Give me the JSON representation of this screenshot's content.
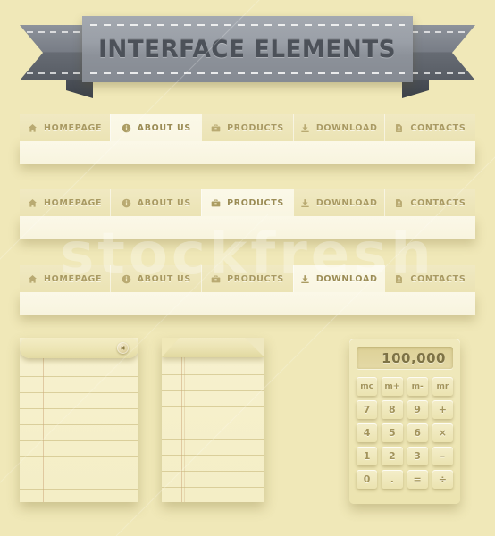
{
  "page": {
    "background_color": "#f0e8b8",
    "watermark_text": "stockfresh"
  },
  "banner": {
    "title": "INTERFACE ELEMENTS",
    "ribbon_color": "#9a9fa7",
    "title_color": "#4c5159"
  },
  "navbars": [
    {
      "name": "navbar-1",
      "active_index": 1,
      "tabs": [
        {
          "label": "HOMEPAGE",
          "icon": "home-icon"
        },
        {
          "label": "ABOUT US",
          "icon": "info-icon"
        },
        {
          "label": "PRODUCTS",
          "icon": "briefcase-icon"
        },
        {
          "label": "DOWNLOAD",
          "icon": "download-icon"
        },
        {
          "label": "CONTACTS",
          "icon": "contact-card-icon"
        }
      ]
    },
    {
      "name": "navbar-2",
      "active_index": 2,
      "tabs": [
        {
          "label": "HOMEPAGE",
          "icon": "home-icon"
        },
        {
          "label": "ABOUT US",
          "icon": "info-icon"
        },
        {
          "label": "PRODUCTS",
          "icon": "briefcase-icon"
        },
        {
          "label": "DOWNLOAD",
          "icon": "download-icon"
        },
        {
          "label": "CONTACTS",
          "icon": "contact-card-icon"
        }
      ]
    },
    {
      "name": "navbar-3",
      "active_index": 3,
      "tabs": [
        {
          "label": "HOMEPAGE",
          "icon": "home-icon"
        },
        {
          "label": "ABOUT US",
          "icon": "info-icon"
        },
        {
          "label": "PRODUCTS",
          "icon": "briefcase-icon"
        },
        {
          "label": "DOWNLOAD",
          "icon": "download-icon"
        },
        {
          "label": "CONTACTS",
          "icon": "contact-card-icon"
        }
      ]
    }
  ],
  "notepads": [
    {
      "name": "notepad-clip",
      "has_clip": true,
      "clip_icon": "brad-fastener-icon",
      "line_count": 10
    },
    {
      "name": "notepad-curl",
      "has_clip": false,
      "line_count": 10
    }
  ],
  "calculator": {
    "display_value": "100,000",
    "display_color": "#ddd197",
    "keys": [
      "mc",
      "m+",
      "m-",
      "mr",
      "7",
      "8",
      "9",
      "+",
      "4",
      "5",
      "6",
      "×",
      "1",
      "2",
      "3",
      "–",
      "0",
      ".",
      "=",
      "÷"
    ]
  }
}
